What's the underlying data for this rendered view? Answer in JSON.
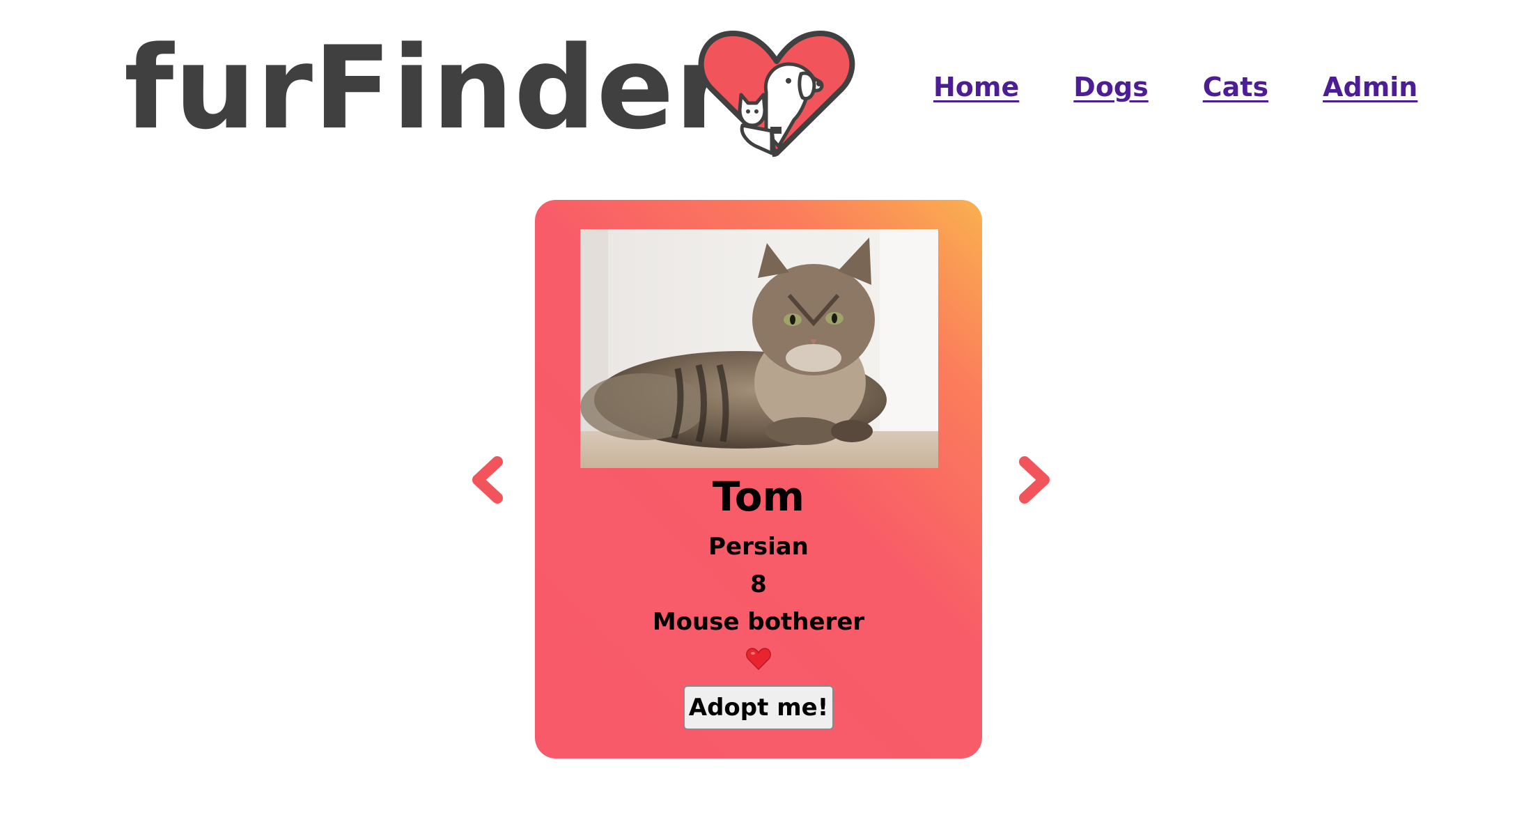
{
  "header": {
    "brand": "furFinder",
    "nav": [
      {
        "label": "Home"
      },
      {
        "label": "Dogs"
      },
      {
        "label": "Cats"
      },
      {
        "label": "Admin"
      }
    ]
  },
  "icons": {
    "logo": "heart-with-dog-and-cat-icon",
    "prev": "chevron-left-icon",
    "next": "chevron-right-icon",
    "favorite": "red-heart-icon"
  },
  "colors": {
    "brand_text": "#404040",
    "nav_link": "#4c1d95",
    "accent": "#f85a6a",
    "card_gradient_top": "#f9b14f"
  },
  "pet": {
    "name": "Tom",
    "breed": "Persian",
    "age": "8",
    "description": "Mouse botherer",
    "heart": "❤️",
    "adopt_label": "Adopt me!"
  }
}
